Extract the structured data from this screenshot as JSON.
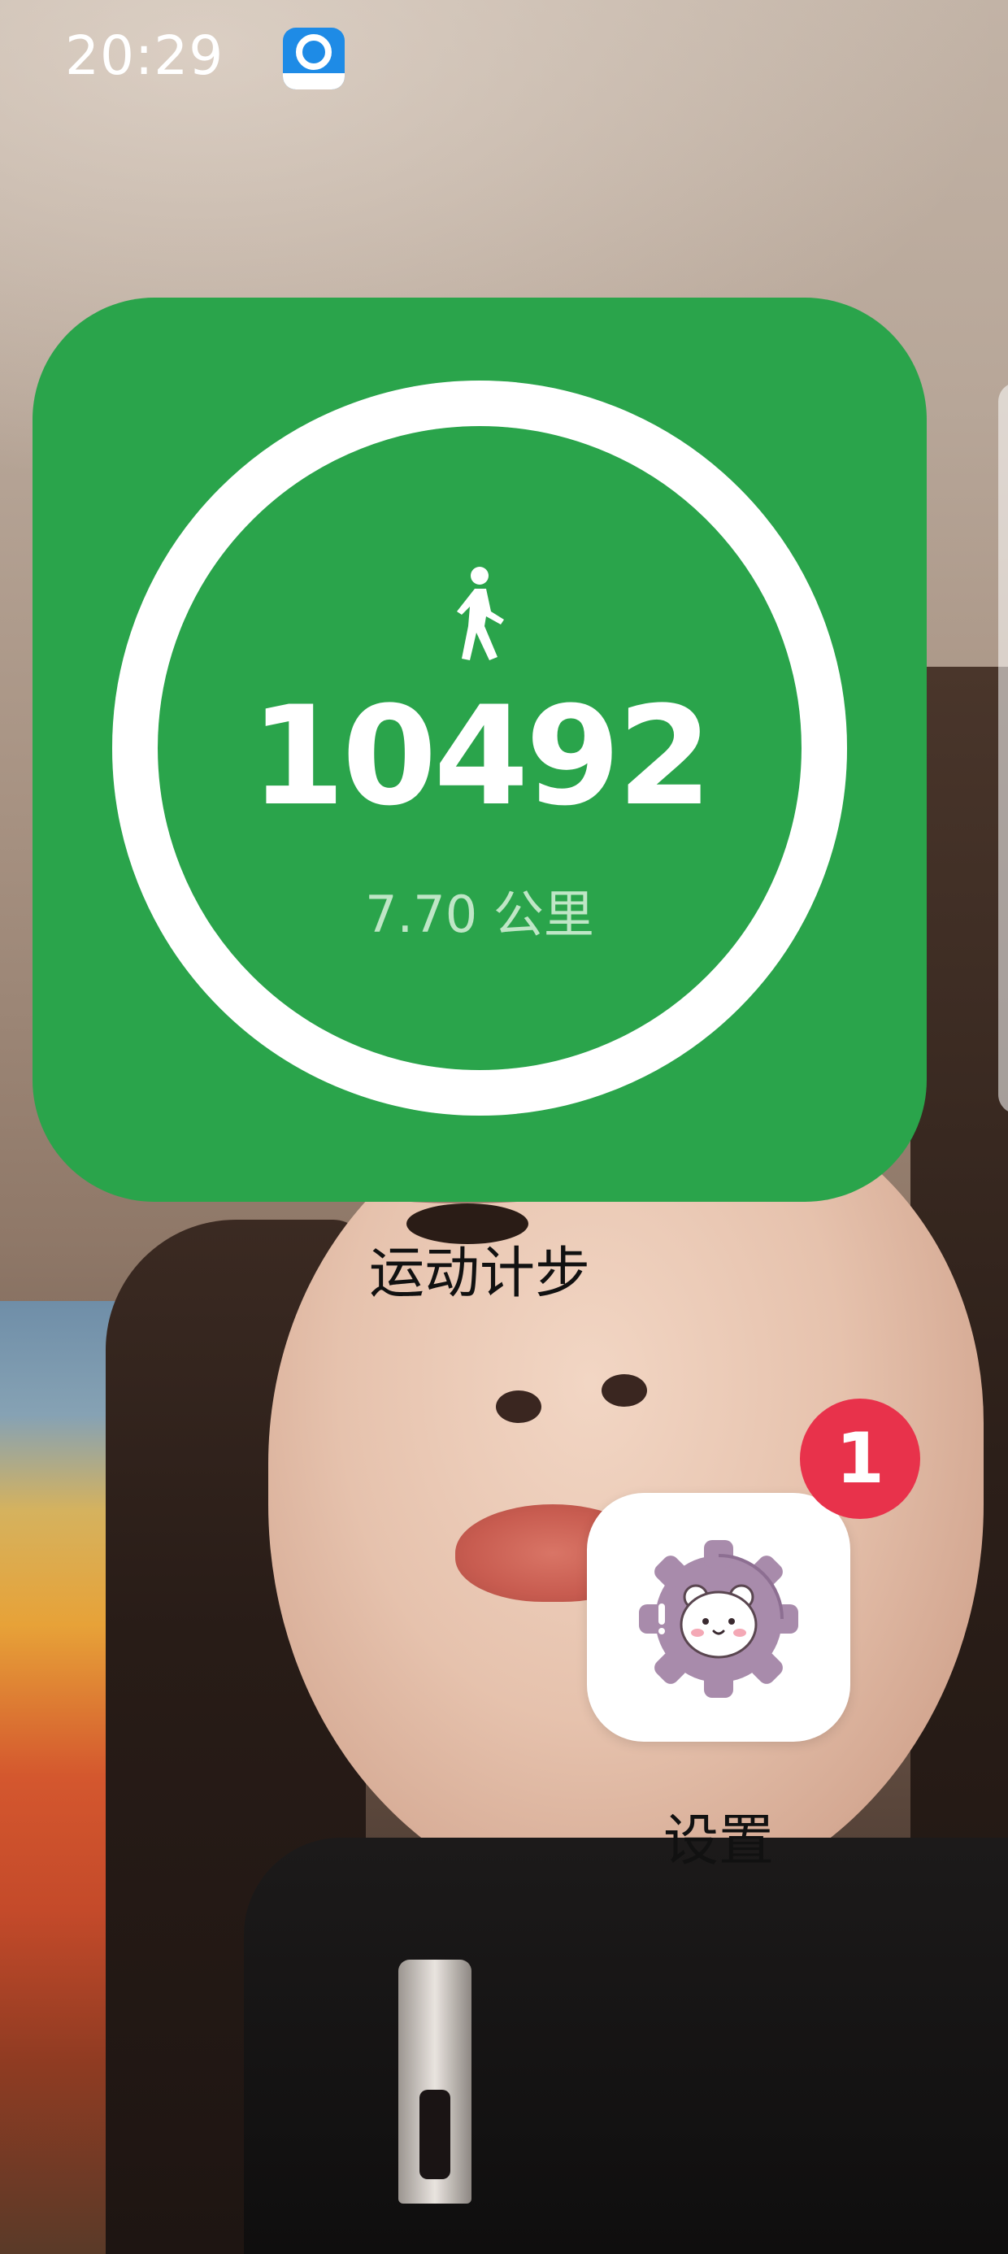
{
  "status_bar": {
    "time": "20:29",
    "notification_app_icon": "browser-app-icon"
  },
  "step_widget": {
    "icon": "walking-person-icon",
    "steps": "10492",
    "distance": "7.70 公里",
    "label": "运动计步",
    "background_color": "#2aa44b",
    "ring_color": "#ffffff",
    "ring_progress": 1.0
  },
  "settings_app": {
    "label": "设置",
    "icon": "bear-gear-icon",
    "badge_count": "1",
    "badge_color": "#e8324b"
  }
}
